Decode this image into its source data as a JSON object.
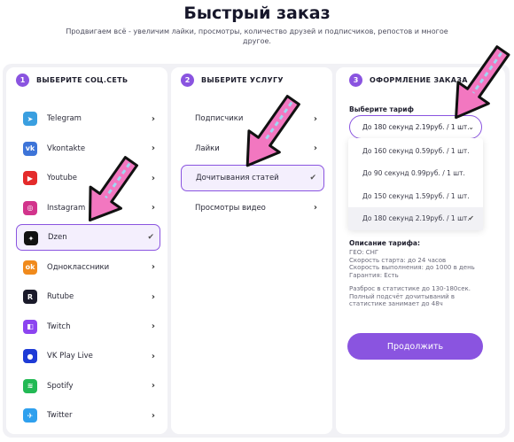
{
  "header": {
    "title": "Быстрый заказ",
    "subtitle": "Продвигаем всё - увеличим лайки, просмотры, количество друзей и подписчиков, репостов и многое другое."
  },
  "steps": [
    {
      "num": "1",
      "label": "ВЫБЕРИТЕ СОЦ.СЕТЬ"
    },
    {
      "num": "2",
      "label": "ВЫБЕРИТЕ УСЛУГУ"
    },
    {
      "num": "3",
      "label": "ОФОРМЛЕНИЕ ЗАКАЗА"
    }
  ],
  "socials": [
    {
      "name": "Telegram",
      "icon": "telegram-icon",
      "glyph": "➤",
      "color": "#3a9fe0"
    },
    {
      "name": "Vkontakte",
      "icon": "vk-icon",
      "glyph": "vk",
      "color": "#3d74d8"
    },
    {
      "name": "Youtube",
      "icon": "youtube-icon",
      "glyph": "▶",
      "color": "#e42b2b"
    },
    {
      "name": "Instagram",
      "icon": "instagram-icon",
      "glyph": "◎",
      "color": "#d2348c"
    },
    {
      "name": "Dzen",
      "icon": "dzen-icon",
      "glyph": "✦",
      "color": "#111111"
    },
    {
      "name": "Одноклассники",
      "icon": "odnoklassniki-icon",
      "glyph": "ok",
      "color": "#f08a1c"
    },
    {
      "name": "Rutube",
      "icon": "rutube-icon",
      "glyph": "R",
      "color": "#1a1a2a"
    },
    {
      "name": "Twitch",
      "icon": "twitch-icon",
      "glyph": "◧",
      "color": "#8c44f0"
    },
    {
      "name": "VK Play Live",
      "icon": "vkplay-icon",
      "glyph": "●",
      "color": "#1e3bd6"
    },
    {
      "name": "Spotify",
      "icon": "spotify-icon",
      "glyph": "≋",
      "color": "#22b954"
    },
    {
      "name": "Twitter",
      "icon": "twitter-icon",
      "glyph": "✈",
      "color": "#2fa0ee"
    }
  ],
  "selected_social": "Dzen",
  "services": [
    "Подписчики",
    "Лайки",
    "Дочитывания статей",
    "Просмотры видео"
  ],
  "selected_service": "Дочитывания статей",
  "order": {
    "tariff_label": "Выберите тариф",
    "tariff_value": "До 180 секунд 2.19руб. / 1 шт.",
    "options": [
      "До 160 секунд 0.59руб. / 1 шт.",
      "До 90 секунд 0.99руб. / 1 шт.",
      "До 150 секунд 1.59руб. / 1 шт.",
      "До 180 секунд 2.19руб. / 1 шт."
    ],
    "description_title": "Описание тарифа:",
    "description_lines": [
      "ГЕО: СНГ",
      "Скорость старта: до 24 часов",
      "Скорость выполнения: до 1000 в день",
      "Гарантия: Есть"
    ],
    "note_lines": [
      "Разброс в статистике до 130-180сек.",
      "Полный подсчёт дочитываний в",
      "статистике занимает до 48ч"
    ],
    "continue_label": "Продолжить"
  },
  "icons": {
    "chevron": "chevron-right-icon",
    "check": "check-icon",
    "dropdown_arrow": "chevron-down-icon"
  },
  "colors": {
    "accent": "#8a54e0",
    "panel_bg": "#f1f1f5",
    "arrow_fill": "#f277c0",
    "arrow_stripe": "#9ed8f2"
  }
}
